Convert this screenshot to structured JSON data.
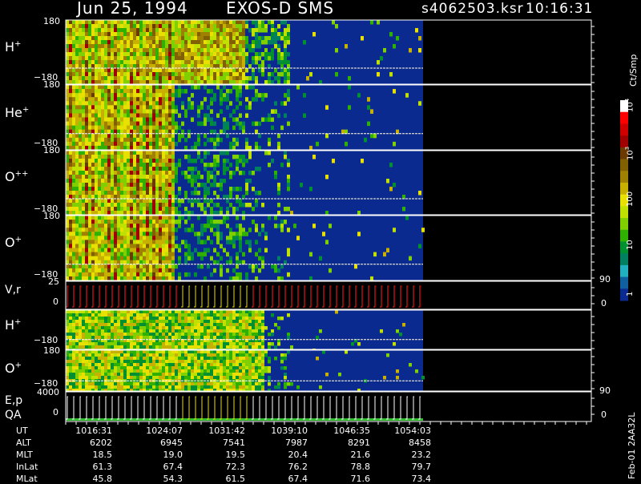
{
  "header": {
    "date": "Jun 25, 1994",
    "instrument": "EXOS-D SMS",
    "file": "s4062503.ksr",
    "time": "10:16:31"
  },
  "panels": [
    {
      "label": "H",
      "sup": "+",
      "ytop": "180",
      "ybot": "−180"
    },
    {
      "label": "He",
      "sup": "+",
      "ytop": "180",
      "ybot": "−180"
    },
    {
      "label": "O",
      "sup": "++",
      "ytop": "180",
      "ybot": "−180"
    },
    {
      "label": "O",
      "sup": "+",
      "ytop": "180",
      "ybot": "−180"
    },
    {
      "label": "V,r",
      "sup": "",
      "ytop": "25",
      "ybot": "0",
      "rtop": "90",
      "rbot": "0"
    },
    {
      "label": "H",
      "sup": "+",
      "ytop": "180",
      "ybot": "−180"
    },
    {
      "label": "O",
      "sup": "+",
      "ytop": "180",
      "ybot": "−180"
    },
    {
      "label": "E,p",
      "label2": "QA",
      "sup": "",
      "ytop": "4000",
      "ybot": "0",
      "rtop": "90",
      "rbot": "0"
    }
  ],
  "colorbar": {
    "title": "Ct/Smp",
    "ticks": [
      "10",
      "4",
      "10",
      "3",
      "100",
      "10",
      "1"
    ],
    "colors": [
      "#ffffff",
      "#ff0000",
      "#d00000",
      "#a00000",
      "#6a3a00",
      "#806000",
      "#a08000",
      "#c8b000",
      "#e8e000",
      "#c0e000",
      "#80d000",
      "#30b000",
      "#009030",
      "#008060",
      "#20b0c0",
      "#1060a0",
      "#0a2a90"
    ]
  },
  "footer": {
    "rows": [
      {
        "label": "UT",
        "values": [
          "1016:31",
          "1024:07",
          "1031:42",
          "1039:10",
          "1046:35",
          "1054:03"
        ]
      },
      {
        "label": "ALT",
        "values": [
          "6202",
          "6945",
          "7541",
          "7987",
          "8291",
          "8458"
        ]
      },
      {
        "label": "MLT",
        "values": [
          "18.5",
          "19.0",
          "19.5",
          "20.4",
          "21.6",
          "23.2"
        ]
      },
      {
        "label": "InLat",
        "values": [
          "61.3",
          "67.4",
          "72.3",
          "76.2",
          "78.8",
          "79.7"
        ]
      },
      {
        "label": "MLat",
        "values": [
          "45.8",
          "54.3",
          "61.5",
          "67.4",
          "71.6",
          "73.4"
        ]
      }
    ],
    "side_text": "Feb-01 2AA32L"
  },
  "chart_data": {
    "type": "heatmap",
    "title": "Jun 25, 1994 EXOS-D SMS",
    "x": [
      "1016:31",
      "1024:07",
      "1031:42",
      "1039:10",
      "1046:35",
      "1054:03"
    ],
    "series": [
      {
        "name": "H+",
        "ylim": [
          -180,
          180
        ]
      },
      {
        "name": "He+",
        "ylim": [
          -180,
          180
        ]
      },
      {
        "name": "O++",
        "ylim": [
          -180,
          180
        ]
      },
      {
        "name": "O+",
        "ylim": [
          -180,
          180
        ]
      },
      {
        "name": "V,r",
        "ylim": [
          0,
          25
        ],
        "ylim_right": [
          0,
          90
        ]
      },
      {
        "name": "H+",
        "ylim": [
          -180,
          180
        ]
      },
      {
        "name": "O+",
        "ylim": [
          -180,
          180
        ]
      },
      {
        "name": "E,p QA",
        "ylim": [
          0,
          4000
        ],
        "ylim_right": [
          0,
          90
        ]
      }
    ],
    "colorbar": {
      "label": "Ct/Smp",
      "scale": "log",
      "range": [
        1,
        10000
      ]
    }
  }
}
